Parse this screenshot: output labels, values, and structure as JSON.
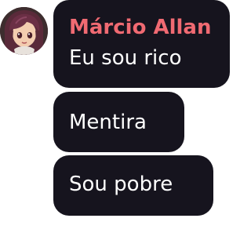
{
  "message_group": {
    "sender": {
      "name": "Márcio Allan",
      "name_color": "#f06a72",
      "avatar_icon": "anime-girl-avatar"
    },
    "bubble_color": "#16141e",
    "messages": [
      {
        "text": "Eu sou rico"
      },
      {
        "text": "Mentira"
      },
      {
        "text": "Sou pobre"
      }
    ]
  }
}
